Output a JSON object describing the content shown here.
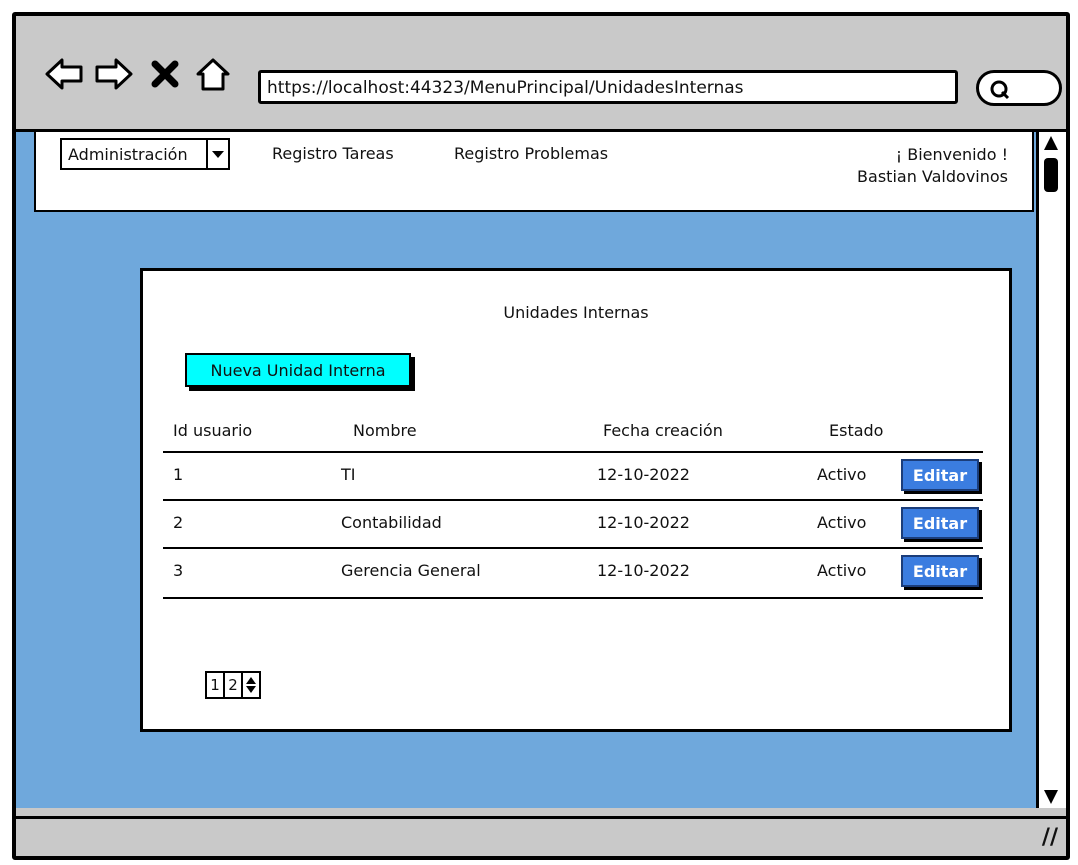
{
  "browser": {
    "url": "https://localhost:44323/MenuPrincipal/UnidadesInternas"
  },
  "nav": {
    "dropdown_label": "Administración",
    "links": [
      "Registro Tareas",
      "Registro Problemas"
    ],
    "welcome_line1": "¡ Bienvenido !",
    "welcome_line2": "Bastian Valdovinos"
  },
  "card": {
    "title": "Unidades Internas",
    "new_button": "Nueva Unidad Interna",
    "headers": {
      "id": "Id usuario",
      "name": "Nombre",
      "date": "Fecha creación",
      "status": "Estado"
    },
    "rows": [
      {
        "id": "1",
        "name": "TI",
        "date": "12-10-2022",
        "status": "Activo",
        "action": "Editar"
      },
      {
        "id": "2",
        "name": "Contabilidad",
        "date": "12-10-2022",
        "status": "Activo",
        "action": "Editar"
      },
      {
        "id": "3",
        "name": "Gerencia General",
        "date": "12-10-2022",
        "status": "Activo",
        "action": "Editar"
      }
    ],
    "pages": [
      "1",
      "2"
    ]
  },
  "colors": {
    "background": "#6fa8dc",
    "new_button": "#00ffff",
    "edit_button": "#3b7de0"
  },
  "icons": [
    "back-arrow-icon",
    "forward-arrow-icon",
    "close-icon",
    "home-icon",
    "search-icon",
    "chevron-down-icon"
  ]
}
